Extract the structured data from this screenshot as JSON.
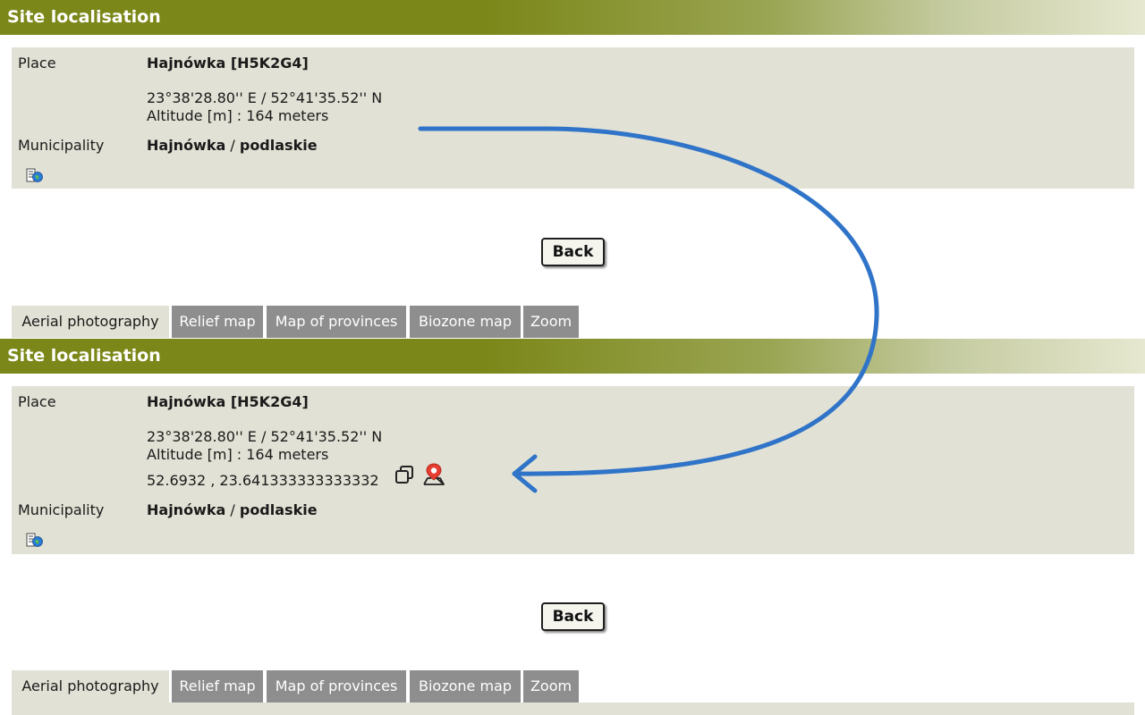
{
  "section_title": "Site localisation",
  "place_label": "Place",
  "place_name": "Hajnówka [H5K2G4]",
  "coordinates_dms": "23°38'28.80'' E / 52°41'35.52'' N",
  "altitude_text": "Altitude [m] : 164 meters",
  "decimal_coordinates": "52.6932 , 23.641333333333332",
  "municipality_label": "Municipality",
  "municipality_name": "Hajnówka",
  "municipality_separator": "/",
  "province_name": "podlaskie",
  "back_button_label": "Back",
  "tabs": [
    {
      "label": "Aerial photography",
      "active": true
    },
    {
      "label": "Relief map",
      "active": false
    },
    {
      "label": "Map of provinces",
      "active": false
    },
    {
      "label": "Biozone map",
      "active": false
    },
    {
      "label": "Zoom",
      "active": false
    }
  ],
  "colors": {
    "header_green": "#7b8718",
    "panel_beige": "#e2e1d5",
    "tab_grey": "#8e8e8e",
    "arrow_blue": "#2f74c8",
    "map_pin_red": "#e53d2f"
  },
  "icons": [
    "map-export-icon",
    "copy-icon",
    "map-pin-icon",
    "curved-arrow-icon"
  ]
}
